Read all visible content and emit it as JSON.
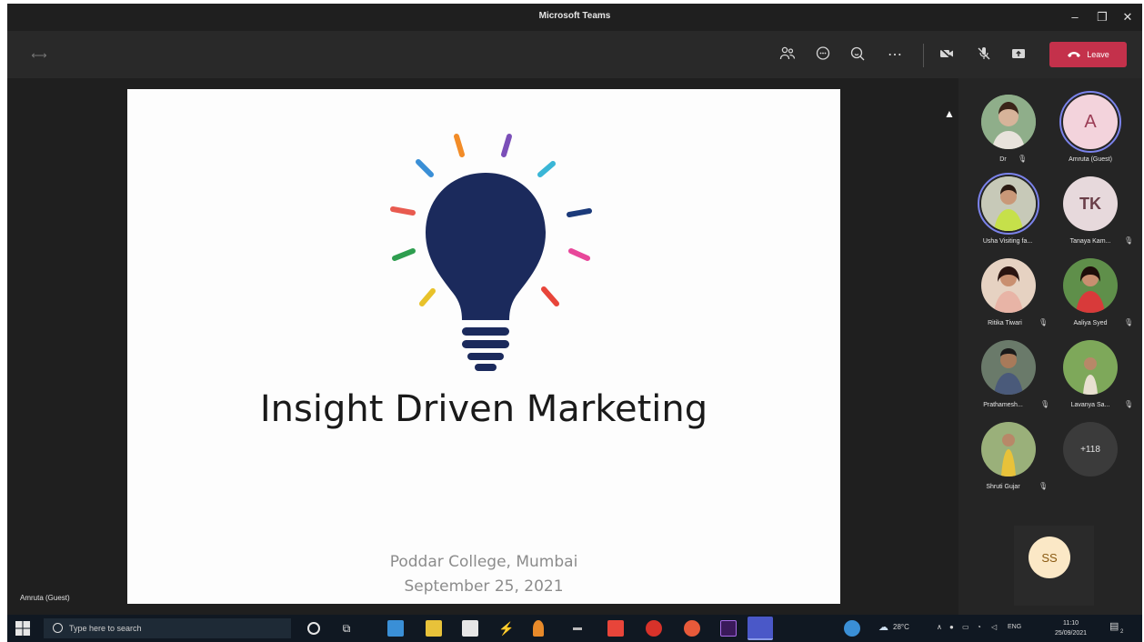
{
  "window": {
    "title": "Microsoft Teams",
    "min": "–",
    "restore": "❐",
    "close": "✕"
  },
  "toolbar": {
    "participants_icon": "people-icon",
    "chat_icon": "chat-icon",
    "reactions_icon": "react-icon",
    "more_icon": "⋯",
    "camera_icon": "camera-off-icon",
    "mic_icon": "mic-off-icon",
    "share_icon": "share-screen-icon",
    "leave_label": "Leave",
    "leave_color": "#c4314b"
  },
  "slide": {
    "title": "Insight Driven Marketing",
    "org": "Poddar College, Mumbai",
    "date": "September 25, 2021",
    "bulb_color": "#1b2a5c"
  },
  "presenter": {
    "label": "Amruta (Guest)"
  },
  "participants": [
    {
      "name": "Dr",
      "type": "photo"
    },
    {
      "name": "Amruta (Guest)",
      "initials": "A",
      "type": "initials"
    },
    {
      "name": "Usha Visiting fa...",
      "type": "photo"
    },
    {
      "name": "Tanaya Kam...",
      "initials": "TK",
      "type": "initials"
    },
    {
      "name": "Ritika Tiwari",
      "type": "photo"
    },
    {
      "name": "Aaliya Syed",
      "type": "photo"
    },
    {
      "name": "Prathamesh...",
      "type": "photo"
    },
    {
      "name": "Lavanya Sa...",
      "type": "photo"
    },
    {
      "name": "Shruti Gujar",
      "type": "photo"
    },
    {
      "name": "",
      "initials": "+118",
      "type": "more"
    }
  ],
  "self": {
    "initials": "SS"
  },
  "taskbar": {
    "search_placeholder": "Type here to search",
    "weather": "28°C",
    "lang": "ENG",
    "time": "11:10",
    "date": "25/09/2021",
    "notif_count": "2"
  }
}
